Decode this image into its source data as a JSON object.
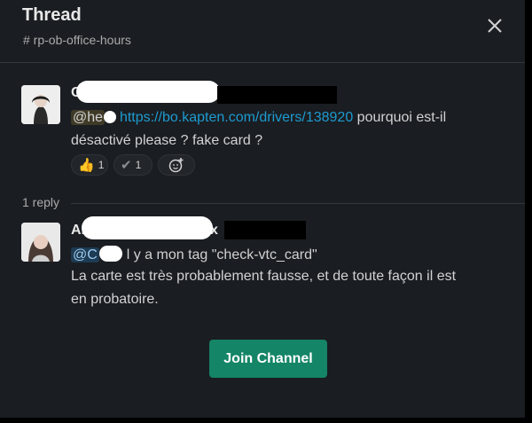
{
  "header": {
    "title": "Thread",
    "channel": "# rp-ob-office-hours"
  },
  "parent_message": {
    "author_visible": "C",
    "mention": "@he",
    "link": "https://bo.kapten.com/drivers/138920",
    "text_after_link": " pourquoi est-il",
    "line2": "désactivé please ? fake card ?",
    "reactions": [
      {
        "emoji": "👍",
        "count": "1"
      },
      {
        "emoji": "✔",
        "count": "1"
      }
    ]
  },
  "reply_count": "1 reply",
  "reply_message": {
    "author_visible": "Ar",
    "author_tail": "x",
    "mention": "@C",
    "line1_tail": "l y a mon tag \"check-vtc_card\"",
    "line2": "La carte est très probablement fausse, et de toute façon il est",
    "line3": "en probatoire."
  },
  "join_button": "Join Channel",
  "colors": {
    "panel_bg": "#1a1d21",
    "link": "#1d9bd1",
    "join_button": "#148567"
  }
}
